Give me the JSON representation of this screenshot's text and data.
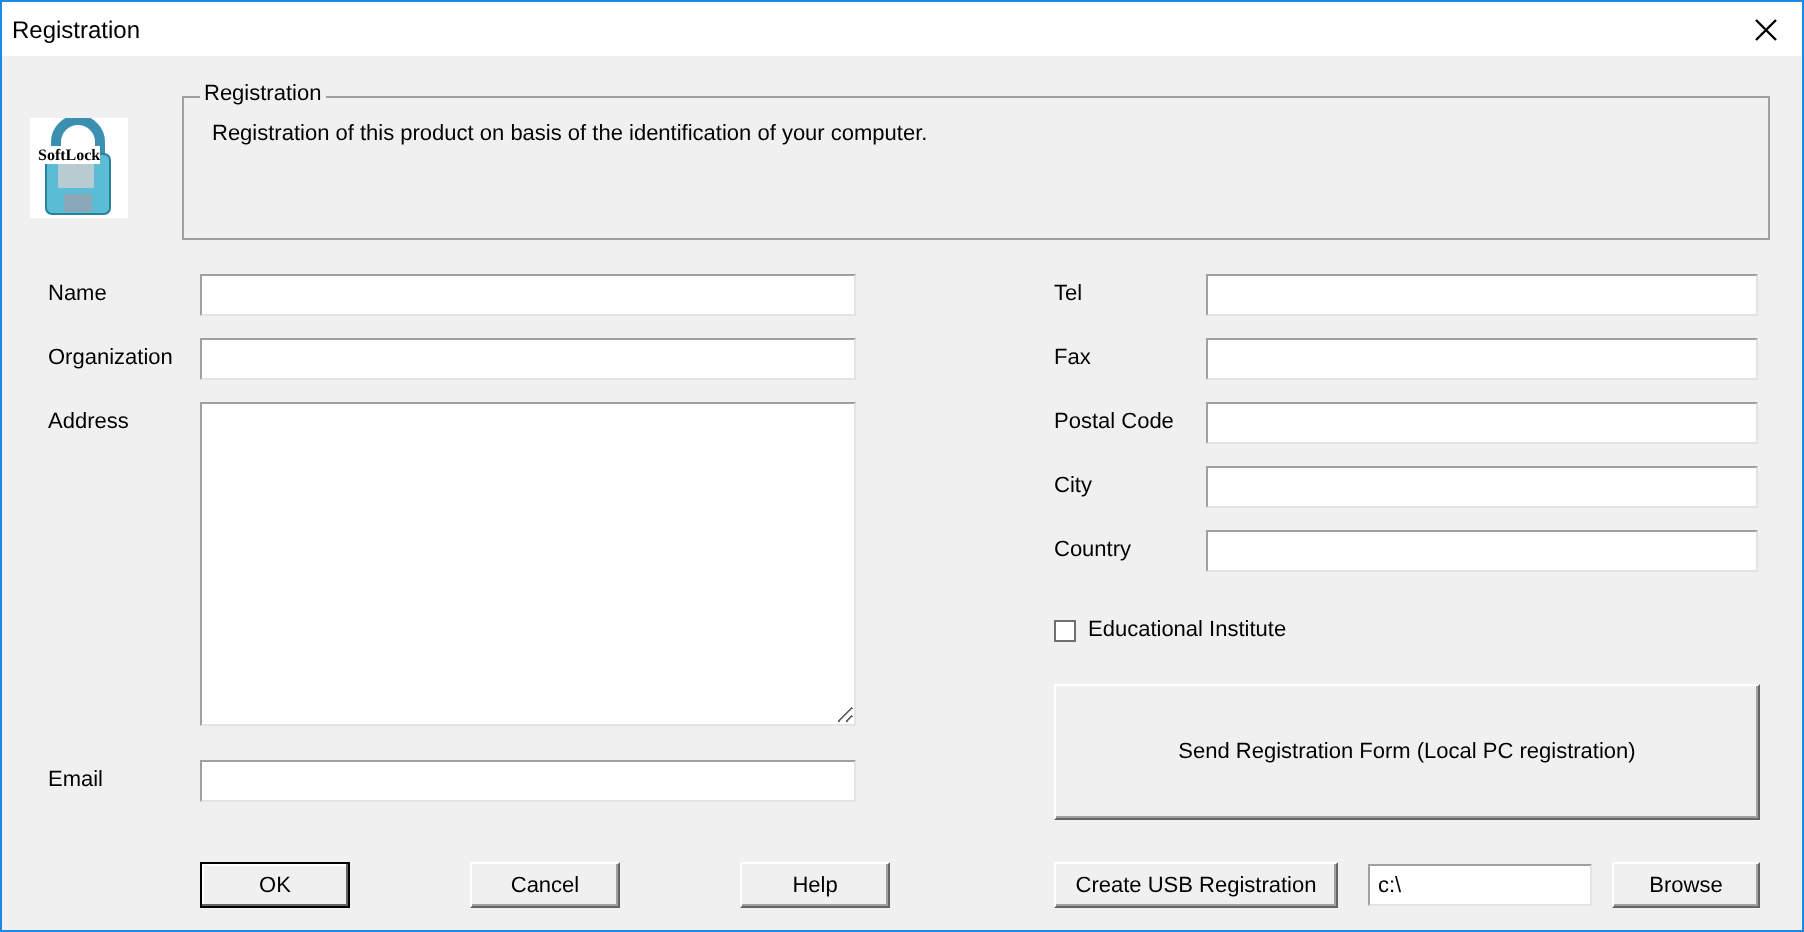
{
  "window": {
    "title": "Registration"
  },
  "logo": {
    "text": "SoftLock"
  },
  "group": {
    "title": "Registration",
    "text": "Registration of this product on basis of the identification of your computer."
  },
  "left_fields": [
    {
      "label": "Name",
      "kind": "line"
    },
    {
      "label": "Organization",
      "kind": "line"
    },
    {
      "label": "Address",
      "kind": "area"
    },
    {
      "label": "Email",
      "kind": "line"
    }
  ],
  "right_fields": [
    {
      "label": "Tel"
    },
    {
      "label": "Fax"
    },
    {
      "label": "Postal Code"
    },
    {
      "label": "City"
    },
    {
      "label": "Country"
    }
  ],
  "checkbox": {
    "label": "Educational Institute",
    "checked": false
  },
  "send_button": "Send Registration Form (Local PC registration)",
  "buttons": [
    "OK",
    "Cancel",
    "Help"
  ],
  "usb": {
    "button": "Create USB Registration",
    "path": "c:\\",
    "browse": "Browse"
  }
}
